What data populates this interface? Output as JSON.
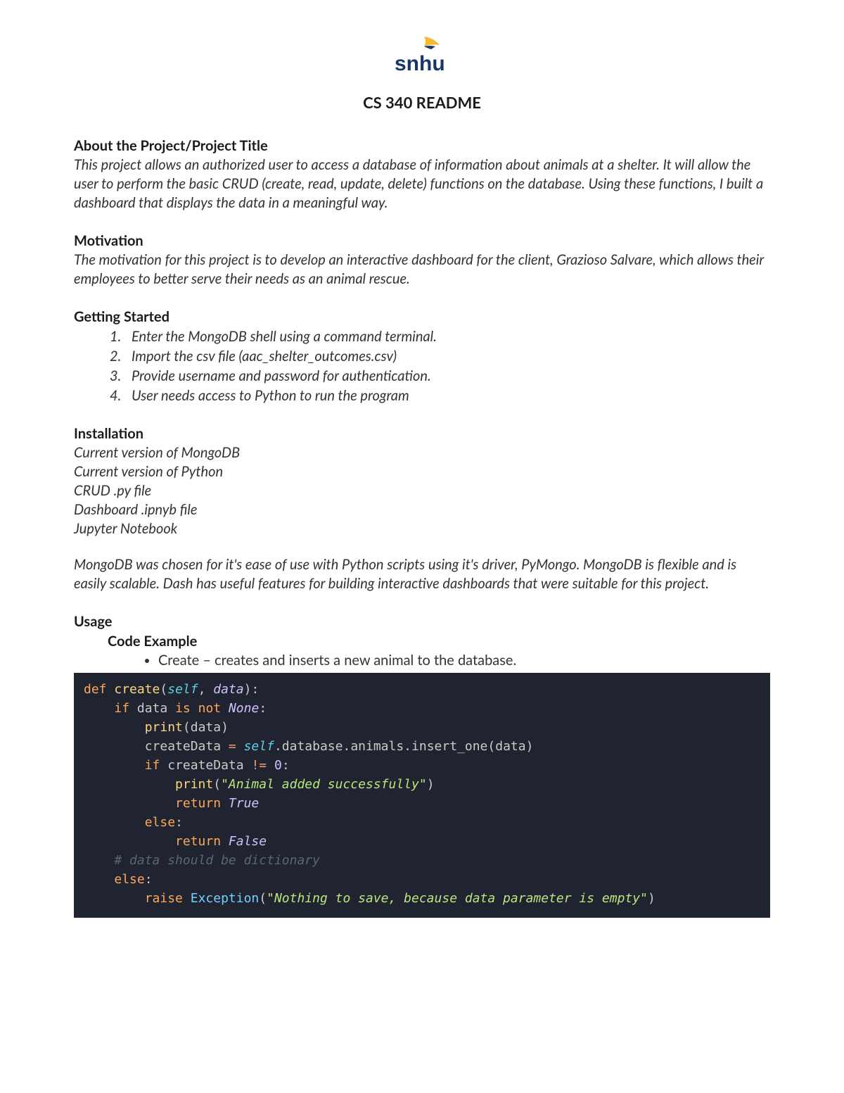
{
  "logo": {
    "text": "snhu"
  },
  "title": "CS 340 README",
  "sections": {
    "about": {
      "heading": "About the Project/Project Title",
      "body": "This project allows an authorized user to access a database of information about animals at a shelter. It will allow the user to perform the basic CRUD (create, read, update, delete) functions on the database. Using these functions, I built a dashboard that displays the data in a meaningful way."
    },
    "motivation": {
      "heading": "Motivation",
      "body": "The motivation for this project is to develop an interactive dashboard for the client, Grazioso Salvare, which allows their employees to better serve their needs as an animal rescue."
    },
    "getting_started": {
      "heading": "Getting Started",
      "steps": [
        "Enter the MongoDB shell using a command terminal.",
        "Import the csv file (aac_shelter_outcomes.csv)",
        "Provide username and password for authentication.",
        "User needs access to Python to run the program"
      ]
    },
    "installation": {
      "heading": "Installation",
      "items": [
        "Current version of MongoDB",
        "Current version of Python",
        "CRUD .py file",
        "Dashboard .ipnyb file",
        "Jupyter Notebook"
      ],
      "note": "MongoDB was chosen for it's ease of use with Python scripts using it's driver, PyMongo. MongoDB is flexible and is easily scalable. Dash has useful features for building interactive dashboards that were suitable for this project."
    },
    "usage": {
      "heading": "Usage",
      "subheading": "Code Example",
      "bullet": "Create – creates and inserts a new animal to the database.",
      "code": {
        "fn_keyword": "def",
        "fn_name": "create",
        "params_open": "(",
        "self": "self",
        "comma": ", ",
        "data_param": "data",
        "params_close": "):",
        "line2_if": "if",
        "line2_data": "data",
        "line2_isnot": "is not",
        "line2_none": "None",
        "line2_colon": ":",
        "line3_print": "print",
        "line3_open": "(",
        "line3_data": "data",
        "line3_close": ")",
        "line4_var": "createData",
        "line4_eq": " = ",
        "line4_self": "self",
        "line4_chain": ".database.animals.insert_one(",
        "line4_data": "data",
        "line4_close": ")",
        "line5_if": "if",
        "line5_var": " createData ",
        "line5_op": "!=",
        "line5_sp": " ",
        "line5_zero": "0",
        "line5_colon": ":",
        "line6_print": "print",
        "line6_open": "(",
        "line6_str": "\"Animal added successfully\"",
        "line6_close": ")",
        "line7_return": "return",
        "line7_true": " True",
        "line8_else": "else",
        "line8_colon": ":",
        "line9_return": "return",
        "line9_false": " False",
        "line10_comment": "# data should be dictionary",
        "line11_else": "else",
        "line11_colon": ":",
        "line12_raise": "raise",
        "line12_exc": " Exception",
        "line12_open": "(",
        "line12_str": "\"Nothing to save, because data parameter is empty\"",
        "line12_close": ")"
      }
    }
  },
  "colors": {
    "brand_navy": "#1a3668",
    "brand_gold": "#f5b82e",
    "code_bg": "#1f2430"
  }
}
